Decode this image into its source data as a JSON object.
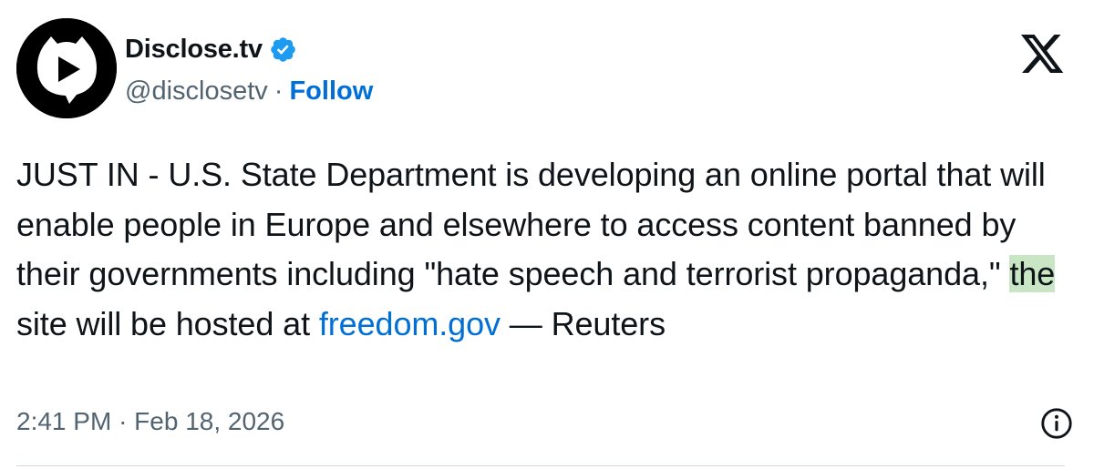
{
  "author": {
    "display_name": "Disclose.tv",
    "handle": "@disclosetv",
    "separator": "·",
    "follow_label": "Follow",
    "verified": true,
    "verified_color": "#1d9bf0"
  },
  "icons": {
    "avatar": "disclose-play-bubble-icon",
    "brand": "x-logo-icon",
    "info": "info-icon"
  },
  "tweet": {
    "segments": {
      "part1": "JUST IN - U.S. State Department is developing an online portal that will enable people in Europe and elsewhere to access content banned by their governments including \"hate speech and terrorist propaganda,\" ",
      "highlight": "the",
      "part2": " site will be hosted at ",
      "link": "freedom.gov",
      "part3": " — Reuters"
    },
    "highlight_color": "#c8e6c3",
    "link_color": "#006fd6"
  },
  "meta": {
    "time": "2:41 PM",
    "separator": "·",
    "date": "Feb 18, 2026"
  }
}
